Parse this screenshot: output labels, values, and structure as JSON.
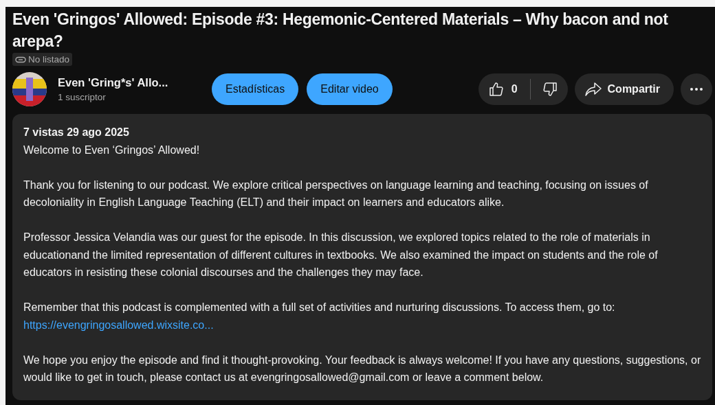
{
  "title": "Even 'Gringos' Allowed: Episode #3: Hegemonic-Centered Materials – Why bacon and not arepa?",
  "visibility": "No listado",
  "channel": {
    "name": "Even 'Gring*s' Allo...",
    "subscribers": "1 suscriptor"
  },
  "buttons": [
    "Estadísticas",
    "Editar video"
  ],
  "likes": "0",
  "share": "Compartir",
  "description": {
    "meta": "7 vistas  29 ago 2025",
    "paragraphs": [
      {
        "text": "Welcome to Even ‘Gringos’ Allowed!"
      },
      {
        "text": "Thank you for listening to our podcast. We explore critical perspectives on language learning and teaching, focusing on issues of decoloniality in English Language Teaching (ELT) and their impact on learners and educators alike."
      },
      {
        "text": "Professor Jessica Velandia was our guest for the episode. In this discussion, we explored topics related to the role of materials in educationand the limited representation of different cultures in textbooks. We also examined the impact on students and the role of educators in resisting these colonial discourses and the challenges they may face."
      },
      {
        "text": "Remember that this podcast is complemented with a full set of activities and nurturing discussions. To access them, go to:",
        "link": "https://evengringosallowed.wixsite.co..."
      },
      {
        "text": "We hope you enjoy the episode and find it thought-provoking. Your feedback is always welcome! If you have any questions, suggestions, or would like to get in touch, please contact us at evengringosallowed@gmail.com or leave a comment below."
      }
    ]
  }
}
